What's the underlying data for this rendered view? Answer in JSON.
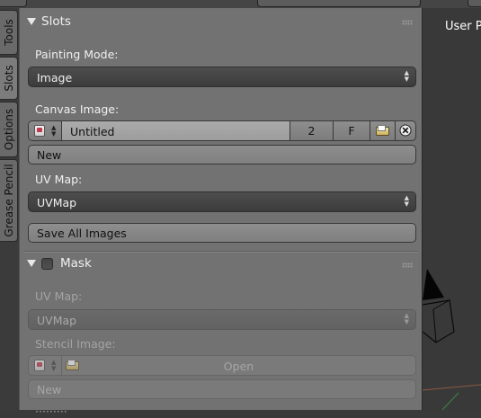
{
  "viewport": {
    "label": "User P"
  },
  "tabs": [
    "Tools",
    "Slots",
    "Options",
    "Grease Pencil"
  ],
  "slots": {
    "title": "Slots",
    "painting_mode_label": "Painting Mode:",
    "painting_mode_value": "Image",
    "canvas_image_label": "Canvas Image:",
    "canvas_image_name": "Untitled",
    "canvas_image_users": "2",
    "canvas_image_fake": "F",
    "new_button": "New",
    "uv_map_label": "UV Map:",
    "uv_map_value": "UVMap",
    "save_all_button": "Save All Images"
  },
  "mask": {
    "title": "Mask",
    "enabled": false,
    "uv_map_label": "UV Map:",
    "uv_map_value": "UVMap",
    "stencil_label": "Stencil Image:",
    "open_button": "Open",
    "new_button": "New"
  },
  "icons": {
    "panel_grip": "drag-grip-icon",
    "image_browse": "image-browse-icon",
    "open_folder": "folder-icon",
    "unlink": "close-icon"
  },
  "colors": {
    "panel_bg": "#727272",
    "viewport_bg": "#393939",
    "dropdown_bg": "#444444"
  }
}
